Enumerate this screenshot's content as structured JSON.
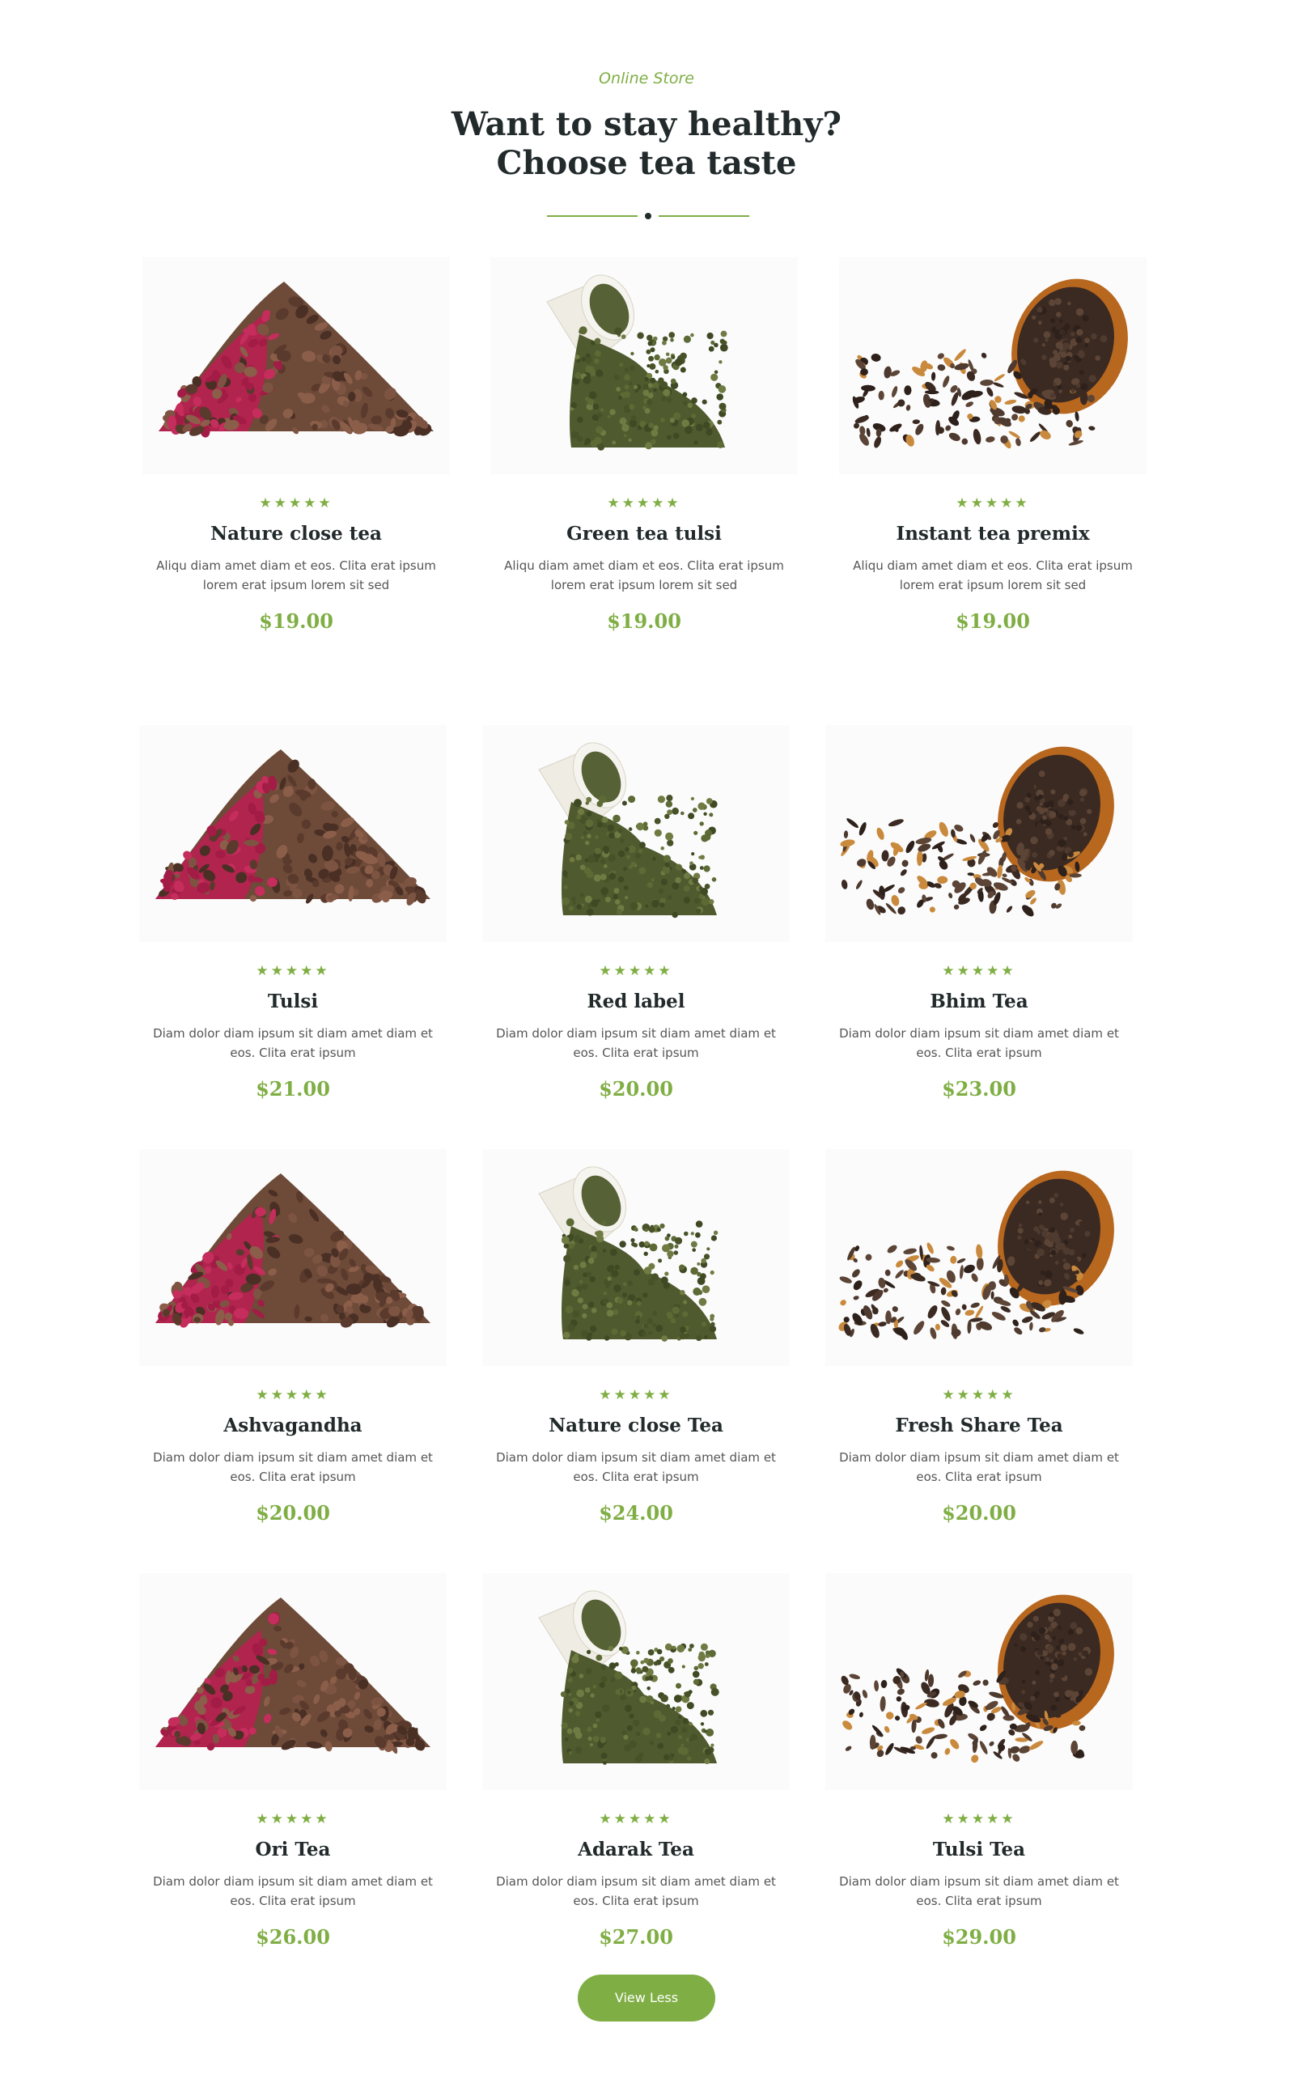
{
  "header": {
    "kicker": "Online Store",
    "title_line1": "Want to stay healthy?",
    "title_line2": "Choose tea taste"
  },
  "colors": {
    "accent": "#7fae44",
    "heading": "#222a2c",
    "text": "#555555"
  },
  "rating_glyphs": "★★★★★",
  "products": [
    {
      "name": "Nature close tea",
      "desc": "Aliqu diam amet diam et eos. Clita erat ipsum lorem erat ipsum lorem sit sed",
      "price": "$19.00",
      "image": "red-tea-pile"
    },
    {
      "name": "Green tea tulsi",
      "desc": "Aliqu diam amet diam et eos. Clita erat ipsum lorem erat ipsum lorem sit sed",
      "price": "$19.00",
      "image": "green-tea-cup"
    },
    {
      "name": "Instant tea premix",
      "desc": "Aliqu diam amet diam et eos. Clita erat ipsum lorem erat ipsum lorem sit sed",
      "price": "$19.00",
      "image": "black-tea-peel"
    },
    {
      "name": "Tulsi",
      "desc": "Diam dolor diam ipsum sit diam amet diam et eos. Clita erat ipsum",
      "price": "$21.00",
      "image": "red-tea-pile"
    },
    {
      "name": "Red label",
      "desc": "Diam dolor diam ipsum sit diam amet diam et eos. Clita erat ipsum",
      "price": "$20.00",
      "image": "green-tea-cup"
    },
    {
      "name": "Bhim Tea",
      "desc": "Diam dolor diam ipsum sit diam amet diam et eos. Clita erat ipsum",
      "price": "$23.00",
      "image": "black-tea-peel"
    },
    {
      "name": "Ashvagandha",
      "desc": "Diam dolor diam ipsum sit diam amet diam et eos. Clita erat ipsum",
      "price": "$20.00",
      "image": "red-tea-pile"
    },
    {
      "name": "Nature close Tea",
      "desc": "Diam dolor diam ipsum sit diam amet diam et eos. Clita erat ipsum",
      "price": "$24.00",
      "image": "green-tea-cup"
    },
    {
      "name": "Fresh Share Tea",
      "desc": "Diam dolor diam ipsum sit diam amet diam et eos. Clita erat ipsum",
      "price": "$20.00",
      "image": "black-tea-peel"
    },
    {
      "name": "Ori Tea",
      "desc": "Diam dolor diam ipsum sit diam amet diam et eos. Clita erat ipsum",
      "price": "$26.00",
      "image": "red-tea-pile"
    },
    {
      "name": "Adarak Tea",
      "desc": "Diam dolor diam ipsum sit diam amet diam et eos. Clita erat ipsum",
      "price": "$27.00",
      "image": "green-tea-cup"
    },
    {
      "name": "Tulsi Tea",
      "desc": "Diam dolor diam ipsum sit diam amet diam et eos. Clita erat ipsum",
      "price": "$29.00",
      "image": "black-tea-peel"
    }
  ],
  "button": {
    "label": "View Less"
  }
}
